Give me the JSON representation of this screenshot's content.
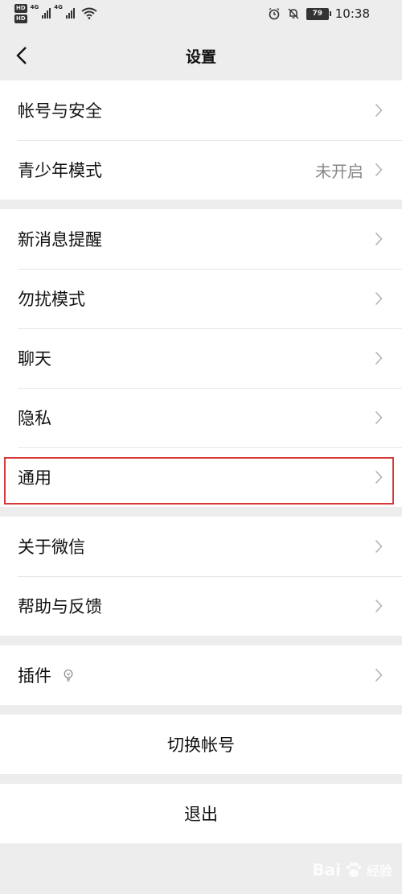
{
  "status_bar": {
    "hd1": "HD",
    "hd2": "HD",
    "net1": "4G",
    "net2": "4G",
    "battery": "79",
    "time": "10:38"
  },
  "navbar": {
    "title": "设置",
    "back_icon": "chevron-left-icon"
  },
  "groups": [
    {
      "items": [
        {
          "label": "帐号与安全",
          "value": ""
        },
        {
          "label": "青少年模式",
          "value": "未开启"
        }
      ]
    },
    {
      "items": [
        {
          "label": "新消息提醒",
          "value": ""
        },
        {
          "label": "勿扰模式",
          "value": ""
        },
        {
          "label": "聊天",
          "value": ""
        },
        {
          "label": "隐私",
          "value": ""
        },
        {
          "label": "通用",
          "value": "",
          "highlighted": true
        }
      ]
    },
    {
      "items": [
        {
          "label": "关于微信",
          "value": ""
        },
        {
          "label": "帮助与反馈",
          "value": ""
        }
      ]
    },
    {
      "items": [
        {
          "label": "插件",
          "value": "",
          "icon": "lightbulb-icon"
        }
      ]
    }
  ],
  "buttons": {
    "switch_account": "切换帐号",
    "logout": "退出"
  },
  "watermark": {
    "brand": "Bai",
    "suffix": "经验"
  },
  "colors": {
    "background": "#ededed",
    "highlight": "#d83a3a",
    "value_text": "#888888"
  }
}
